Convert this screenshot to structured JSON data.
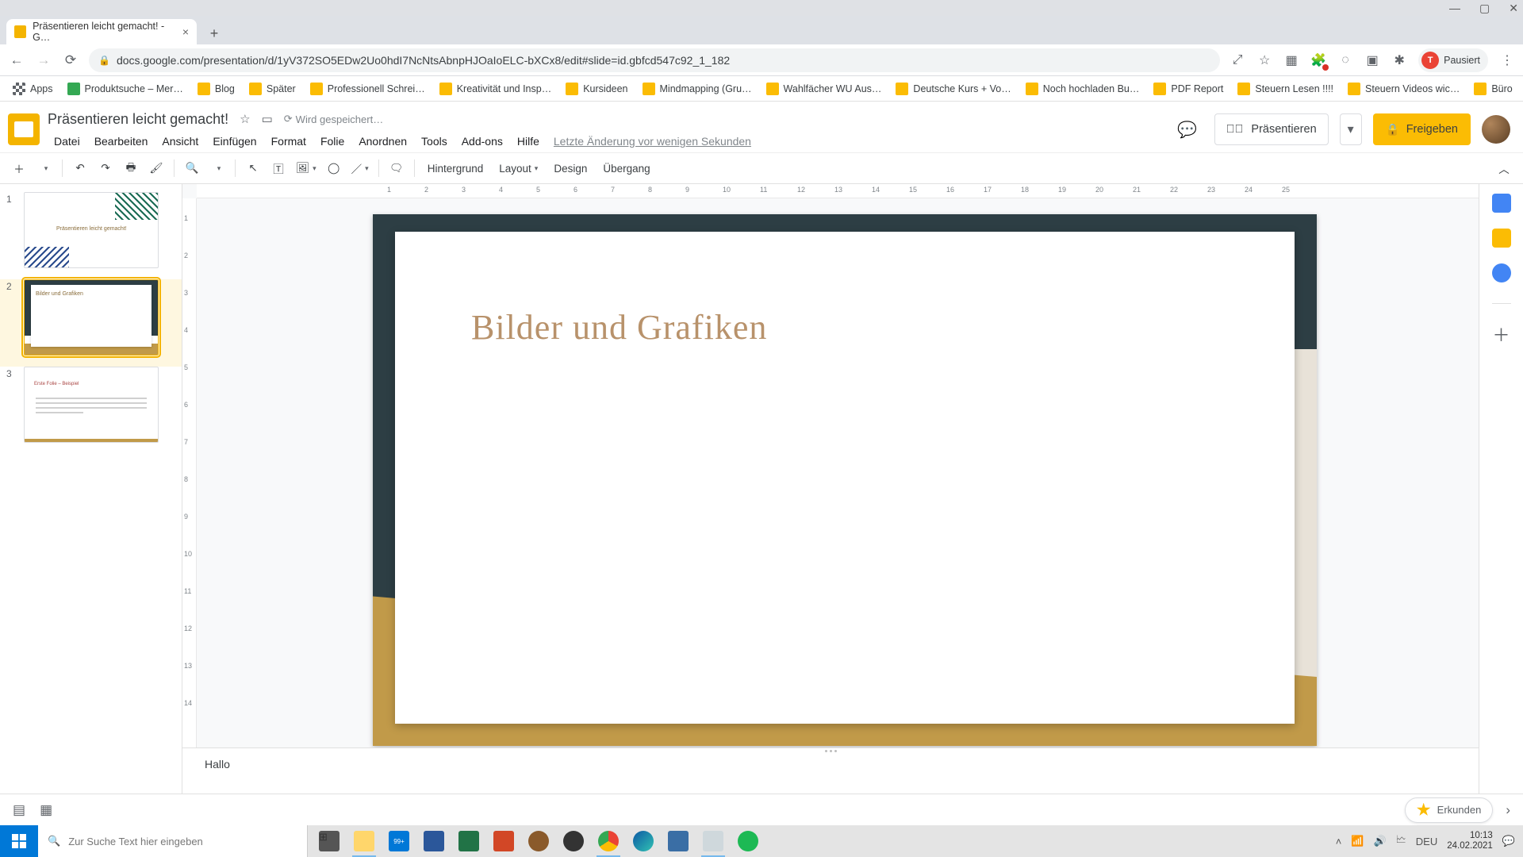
{
  "window": {
    "tab_title": "Präsentieren leicht gemacht! - G…",
    "url": "docs.google.com/presentation/d/1yV372SO5EDw2Uo0hdI7NcNtsAbnpHJOaIoELC-bXCx8/edit#slide=id.gbfcd547c92_1_182",
    "profile_label": "Pausiert"
  },
  "bookmarks": {
    "apps": "Apps",
    "items": [
      "Produktsuche – Mer…",
      "Blog",
      "Später",
      "Professionell Schrei…",
      "Kreativität und Insp…",
      "Kursideen",
      "Mindmapping  (Gru…",
      "Wahlfächer WU Aus…",
      "Deutsche Kurs + Vo…",
      "Noch hochladen Bu…",
      "PDF Report",
      "Steuern Lesen !!!!",
      "Steuern Videos wic…",
      "Büro"
    ]
  },
  "doc": {
    "title": "Präsentieren leicht gemacht!",
    "saving": "Wird gespeichert…",
    "last_change": "Letzte Änderung vor wenigen Sekunden",
    "menus": [
      "Datei",
      "Bearbeiten",
      "Ansicht",
      "Einfügen",
      "Format",
      "Folie",
      "Anordnen",
      "Tools",
      "Add-ons",
      "Hilfe"
    ],
    "present": "Präsentieren",
    "share": "Freigeben"
  },
  "toolbar": {
    "hintergrund": "Hintergrund",
    "layout": "Layout",
    "design": "Design",
    "uebergang": "Übergang"
  },
  "ruler_h": [
    "1",
    "2",
    "3",
    "4",
    "5",
    "6",
    "7",
    "8",
    "9",
    "10",
    "11",
    "12",
    "13",
    "14",
    "15",
    "16",
    "17",
    "18",
    "19",
    "20",
    "21",
    "22",
    "23",
    "24",
    "25"
  ],
  "ruler_v": [
    "1",
    "2",
    "3",
    "4",
    "5",
    "6",
    "7",
    "8",
    "9",
    "10",
    "11",
    "12",
    "13",
    "14"
  ],
  "slides": {
    "thumbs": [
      {
        "num": "1",
        "caption": "Präsentieren leicht gemacht!"
      },
      {
        "num": "2",
        "caption": "Bilder und Grafiken"
      },
      {
        "num": "3",
        "caption": "Erste Folie – Beispiel"
      }
    ],
    "current_title": "Bilder und Grafiken"
  },
  "speaker": {
    "text": "Hallo"
  },
  "explore": {
    "label": "Erkunden"
  },
  "taskbar": {
    "search_placeholder": "Zur Suche Text hier eingeben",
    "lang": "DEU",
    "time": "10:13",
    "date": "24.02.2021",
    "mail_badge": "99+"
  }
}
